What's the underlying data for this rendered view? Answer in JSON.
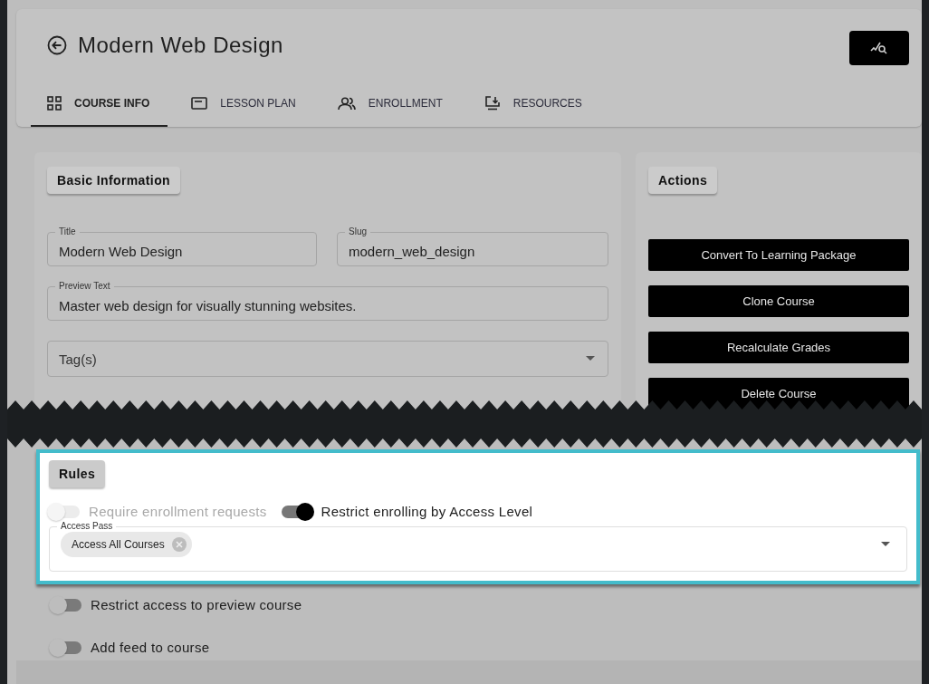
{
  "header": {
    "title": "Modern Web Design"
  },
  "tabs": [
    {
      "label": "COURSE INFO",
      "selected": true
    },
    {
      "label": "LESSON PLAN",
      "selected": false
    },
    {
      "label": "ENROLLMENT",
      "selected": false
    },
    {
      "label": "RESOURCES",
      "selected": false
    }
  ],
  "basic_info": {
    "heading": "Basic Information",
    "fields": [
      {
        "label": "Title",
        "value": "Modern Web Design"
      },
      {
        "label": "Slug",
        "value": "modern_web_design"
      },
      {
        "label": "Preview Text",
        "value": "Master web design for visually stunning websites."
      }
    ],
    "tags": {
      "placeholder": "Tag(s)"
    }
  },
  "actions": {
    "heading": "Actions",
    "buttons": [
      "Convert To Learning Package",
      "Clone Course",
      "Recalculate Grades",
      "Delete Course"
    ]
  },
  "rules": {
    "heading": "Rules",
    "toggles": [
      {
        "label": "Require enrollment requests",
        "on": false,
        "disabled": true
      },
      {
        "label": "Restrict enrolling by Access Level",
        "on": true,
        "disabled": false
      }
    ],
    "access_pass": {
      "label": "Access Pass",
      "chips": [
        "Access All Courses"
      ]
    }
  },
  "more_toggles": [
    {
      "label": "Restrict access to preview course",
      "on": false
    },
    {
      "label": "Add feed to course",
      "on": false
    }
  ]
}
